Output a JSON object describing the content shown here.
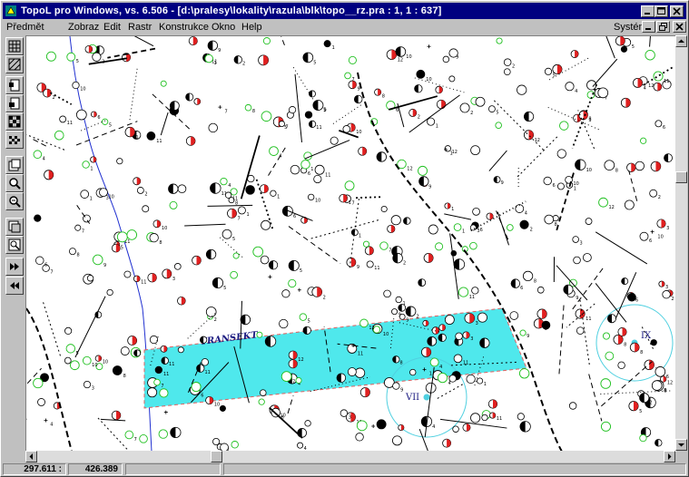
{
  "window": {
    "title": "TopoL pro Windows, vs. 6.506 - [d:\\pralesy\\lokality\\razula\\blk\\topo__rz.pra : 1,  1 : 637]",
    "system_label": "Systém"
  },
  "menu": {
    "items": [
      "Předmět",
      "Zobraz",
      "Edit",
      "Rastr",
      "Konstrukce",
      "Okno",
      "Help"
    ]
  },
  "toolbar": {
    "tools": [
      "grid-icon",
      "grid-diagonal-icon",
      "select-icon",
      "select-area-icon",
      "checker-icon",
      "layers-icon",
      "pan-icon",
      "zoom-in-icon",
      "zoom-out-icon",
      "redraw-icon",
      "zoom-window-icon",
      "next-icon",
      "previous-icon"
    ]
  },
  "map": {
    "transect_label": "TRANSEKT",
    "plot_labels": [
      "VII",
      "IX"
    ],
    "colors": {
      "transect_fill": "#4fe8ec",
      "river": "#2030d0",
      "red_symbol": "#e02020",
      "green_symbol": "#20c020",
      "black_symbol": "#000000",
      "plot_circle": "#50d0e0"
    }
  },
  "status": {
    "x": "297.611 :",
    "y": "426.389"
  }
}
